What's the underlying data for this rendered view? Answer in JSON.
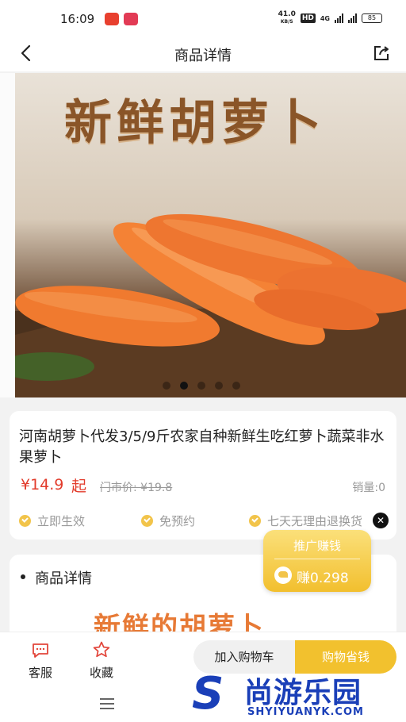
{
  "status": {
    "time": "16:09",
    "net_speed_value": "41.0",
    "net_speed_unit": "KB/S",
    "hd_label": "HD",
    "network_type": "4G",
    "battery": "85"
  },
  "nav": {
    "title": "商品详情",
    "back_icon": "back-arrow-icon",
    "share_icon": "share-icon"
  },
  "hero": {
    "banner_text": "新鲜胡萝卜",
    "dot_count": 5,
    "active_dot": 2
  },
  "product": {
    "name": "河南胡萝卜代发3/5/9斤农家自种新鲜生吃红萝卜蔬菜非水果萝卜",
    "price": "¥14.9",
    "price_suffix": "起",
    "market_price": "门市价: ¥19.8",
    "sales": "销量:0",
    "features": [
      "立即生效",
      "免预约",
      "七天无理由退换货"
    ]
  },
  "promo": {
    "title": "推广赚钱",
    "earn": "赚0.298"
  },
  "detail": {
    "title": "商品详情",
    "banner": "新鲜的胡萝卜"
  },
  "bottom": {
    "service_label": "客服",
    "favorite_label": "收藏",
    "cart_label": "加入购物车",
    "buy_label": "购物省钱"
  },
  "watermark": {
    "brand": "尚游乐园",
    "url": "SHYIYUANYK.COM"
  },
  "colors": {
    "accent": "#f2c12e",
    "price_red": "#e23b2b",
    "brand_blue": "#1a3fb8"
  }
}
